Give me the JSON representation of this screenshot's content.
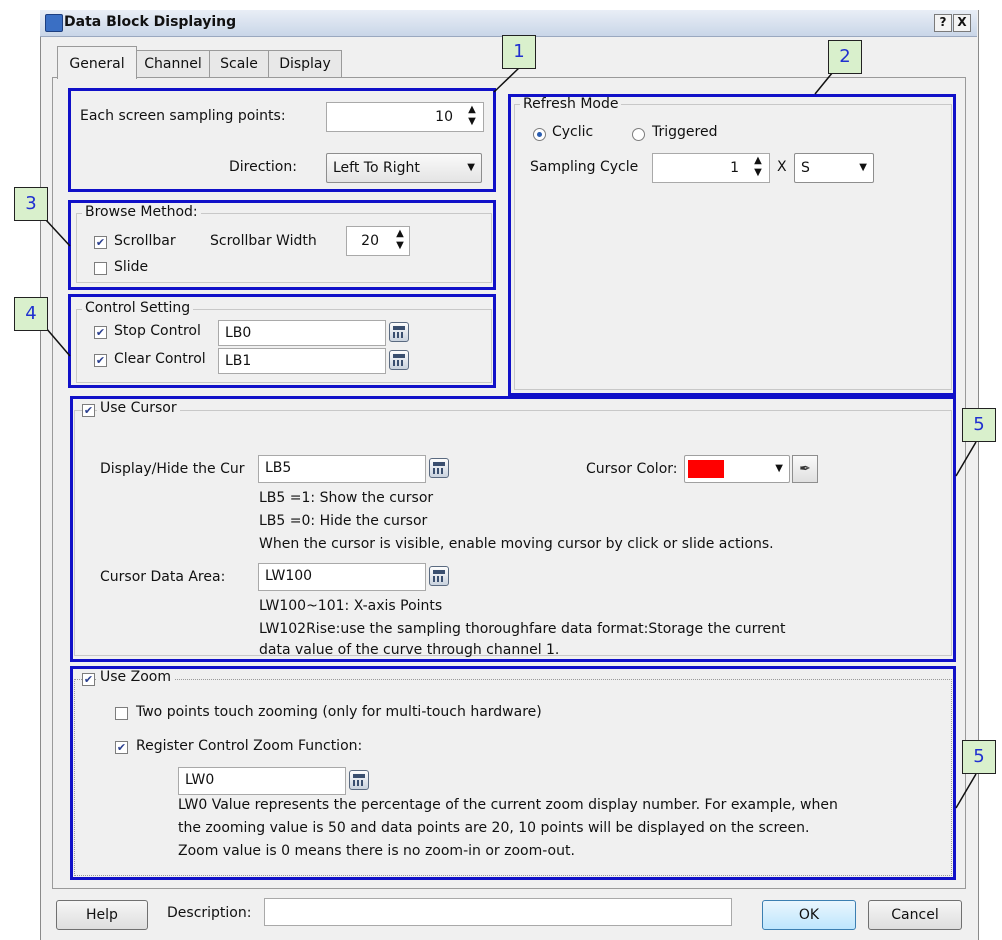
{
  "window": {
    "title": "Data Block Displaying",
    "help_glyph": "?",
    "close_glyph": "X"
  },
  "tabs": [
    {
      "label": "General",
      "active": true
    },
    {
      "label": "Channel",
      "active": false
    },
    {
      "label": "Scale",
      "active": false
    },
    {
      "label": "Display",
      "active": false
    }
  ],
  "sampling": {
    "points_label": "Each screen sampling points:",
    "points_value": "10",
    "direction_label": "Direction:",
    "direction_value": "Left To Right"
  },
  "refresh_mode": {
    "title": "Refresh Mode",
    "cyclic_label": "Cyclic",
    "triggered_label": "Triggered",
    "selected": "Cyclic",
    "sampling_cycle_label": "Sampling Cycle",
    "sampling_cycle_value": "1",
    "multiplier": "X",
    "unit_value": "S"
  },
  "browse_method": {
    "title": "Browse Method:",
    "scrollbar_label": "Scrollbar",
    "scrollbar_checked": true,
    "scrollbar_width_label": "Scrollbar Width",
    "scrollbar_width_value": "20",
    "slide_label": "Slide",
    "slide_checked": false
  },
  "control_setting": {
    "title": "Control Setting",
    "stop_label": "Stop Control",
    "stop_value": "LB0",
    "clear_label": "Clear Control",
    "clear_value": "LB1"
  },
  "cursor": {
    "use_label": "Use Cursor",
    "display_hide_label": "Display/Hide the Cur",
    "display_hide_value": "LB5",
    "note1": "LB5 =1: Show the cursor",
    "note2": "LB5 =0: Hide the cursor",
    "note3": "When the cursor is visible, enable moving cursor by click or slide actions.",
    "color_label": "Cursor Color:",
    "color_value": "#ff0000",
    "data_area_label": "Cursor Data Area:",
    "data_area_value": "LW100",
    "note4": "LW100~101: X-axis Points",
    "note5": "LW102Rise:use the sampling thoroughfare data format:Storage the current",
    "note6": "data value of the curve through channel 1."
  },
  "zoom": {
    "use_label": "Use Zoom",
    "two_points_label": "Two points touch zooming (only for multi-touch hardware)",
    "two_points_checked": false,
    "register_label": "Register Control Zoom Function:",
    "register_checked": true,
    "register_value": "LW0",
    "note1": "LW0 Value represents the percentage of the current zoom display number. For example, when",
    "note2": "the zooming value is 50 and data points are 20, 10 points will be displayed on the screen.",
    "note3": "Zoom value is 0 means there is no zoom-in or zoom-out."
  },
  "footer": {
    "help_label": "Help",
    "description_label": "Description:",
    "description_value": "",
    "ok_label": "OK",
    "cancel_label": "Cancel"
  },
  "callouts": [
    "1",
    "2",
    "3",
    "4",
    "5",
    "5"
  ],
  "colors": {
    "highlight_border": "#1010c8",
    "callout_bg": "#d9f0cc",
    "callout_text": "#2030d0"
  }
}
